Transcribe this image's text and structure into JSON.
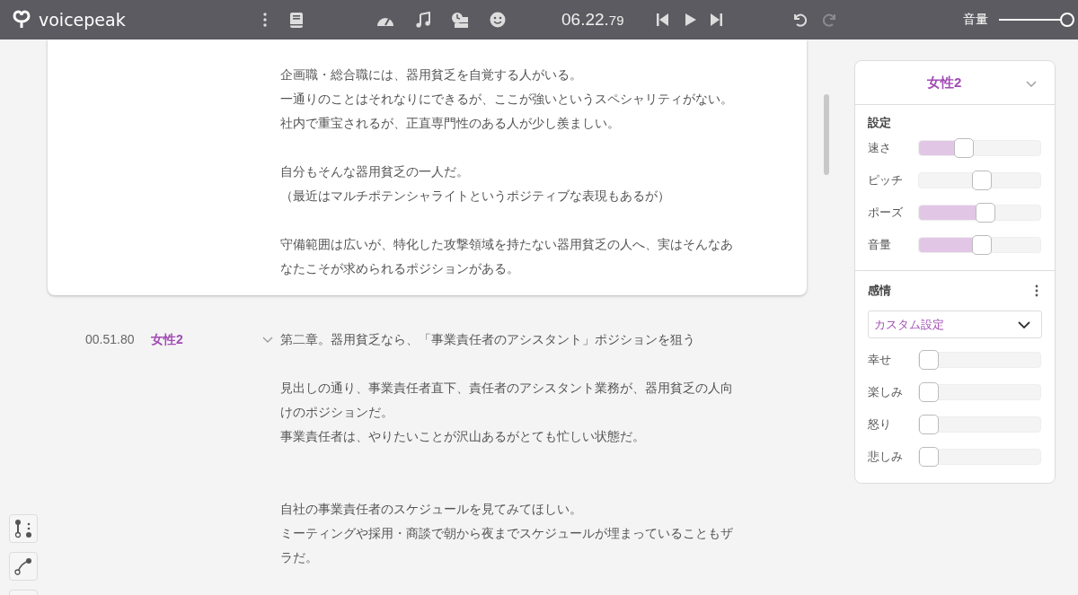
{
  "toolbar": {
    "app_name": "voicepeak",
    "time": "06.22.",
    "time_fraction": "79",
    "undo": {
      "disabled": false
    },
    "redo": {
      "disabled": true
    },
    "volume_label": "音量",
    "volume_level": {
      "level": 1
    }
  },
  "blocks": [
    {
      "selected": true,
      "lines": [
        {
          "kind": "text",
          "text": "企画職・総合職には、器用貧乏を自覚する人がいる。"
        },
        {
          "kind": "text",
          "text": "一通りのことはそれなりにできるが、ここが強いというスペシャリティがない。"
        },
        {
          "kind": "text",
          "text": "社内で重宝されるが、正直専門性のある人が少し羨ましい。"
        },
        {
          "kind": "blank"
        },
        {
          "kind": "text",
          "text": "自分もそんな器用貧乏の一人だ。"
        },
        {
          "kind": "text",
          "text": "（最近はマルチポテンシャライトというポジティブな表現もあるが）"
        },
        {
          "kind": "blank"
        },
        {
          "kind": "text",
          "text": "守備範囲は広いが、特化した攻撃領域を持たない器用貧乏の人へ、実はそんなあなたこそが求められるポジションがある。"
        }
      ]
    },
    {
      "selected": false,
      "time": "00.51.80",
      "speaker": "女性2",
      "lines": [
        {
          "kind": "text",
          "text": "第二章。器用貧乏なら、「事業責任者のアシスタント」ポジションを狙う"
        },
        {
          "kind": "blank"
        },
        {
          "kind": "text",
          "text": "見出しの通り、事業責任者直下、責任者のアシスタント業務が、器用貧乏の人向けのポジションだ。"
        },
        {
          "kind": "text",
          "text": "事業責任者は、やりたいことが沢山あるがとても忙しい状態だ。"
        },
        {
          "kind": "blank"
        },
        {
          "kind": "blank"
        },
        {
          "kind": "text",
          "text": "自社の事業責任者のスケジュールを見てみてほしい。"
        },
        {
          "kind": "text",
          "text": "ミーティングや採用・商談で朝から夜までスケジュールが埋まっていることもザラだ。"
        }
      ]
    }
  ],
  "panel": {
    "speaker": "女性2",
    "settings_title": "設定",
    "settings": [
      {
        "kind": "fill",
        "label": "速さ",
        "level": 0.34
      },
      {
        "kind": "center",
        "label": "ピッチ",
        "level": 0.51
      },
      {
        "kind": "fill",
        "label": "ポーズ",
        "level": 0.55
      },
      {
        "kind": "fill",
        "label": "音量",
        "level": 0.51
      }
    ],
    "emotion_title": "感情",
    "emotion_preset": "カスタム設定",
    "emotions": [
      {
        "label": "幸せ",
        "level": 0
      },
      {
        "label": "楽しみ",
        "level": 0
      },
      {
        "label": "怒り",
        "level": 0
      },
      {
        "label": "悲しみ",
        "level": 0
      }
    ]
  }
}
